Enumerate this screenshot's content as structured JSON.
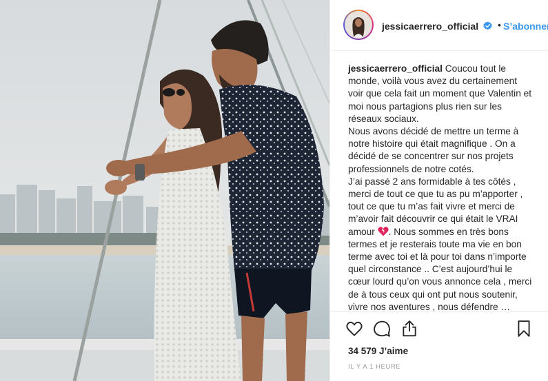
{
  "post": {
    "username": "jessicaerrero_official",
    "follow_separator": "•",
    "follow_label": "S’abonner",
    "caption_username": "jessicaerrero_official",
    "caption_para1": "Coucou tout le monde, voilà vous avez du certainement voir que cela fait un moment que Valentin et moi nous partagions plus rien sur les réseaux sociaux.",
    "caption_para2": "Nous avons décidé de mettre un terme à notre histoire qui était magnifique . On a décidé de se concentrer sur nos projets professionnels de notre cotés.",
    "caption_para3_before_emoji": "J’ai passé 2 ans formidable à tes côtés , merci de tout ce que tu as pu m’apporter , tout ce que tu m’as fait vivre et merci de m’avoir fait découvrir ce qui était le VRAI amour",
    "caption_para3_after_emoji": ". Nous sommes en très bons termes et je resterais toute ma vie en bon terme avec toi et là pour toi dans n’importe quel circonstance .. C’est aujourd’hui le cœur lourd qu’on vous annonce cela , merci de à tous ceux qui ont put nous soutenir, vivre nos aventures , nous défendre … C’est",
    "likes": "34 579 J’aime",
    "timestamp": "IL Y A 1 HEURE"
  },
  "icons": {
    "verified": "verified-badge-icon",
    "like": "heart-icon",
    "comment": "comment-icon",
    "share": "share-icon",
    "save": "bookmark-icon",
    "emoji": "broken-heart-icon"
  },
  "colors": {
    "link_blue": "#3897f0",
    "verified_blue": "#3897f0",
    "text": "#262626",
    "muted": "#999999",
    "broken_heart": "#e0245e"
  }
}
